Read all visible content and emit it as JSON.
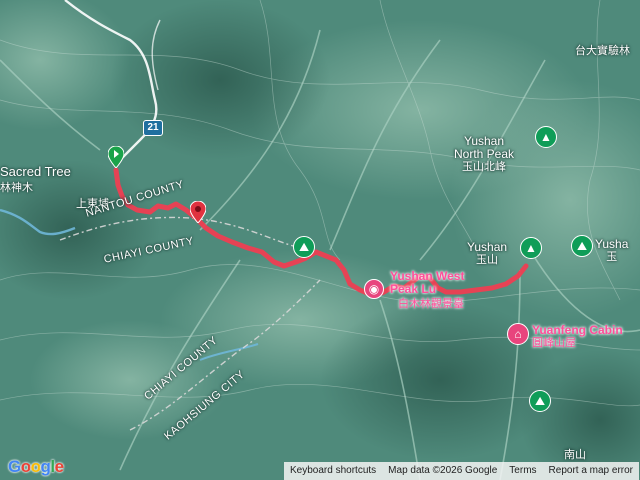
{
  "map": {
    "colors": {
      "terrain": "#4f8a7b",
      "ridge": "#8ab8a6",
      "valley": "#2f5e52",
      "contour": "#c9ddd5",
      "track": "#ee3e52",
      "road": "#ffffff",
      "boundary": "#d8d8d8",
      "river": "#6fb7d8"
    },
    "labels": {
      "sacred_tree_en": "Sacred Tree",
      "sacred_tree_zh": "林神木",
      "shangdongpu": "上東埔",
      "nantou_county": "NANTOU COUNTY",
      "chiayi_county_1": "CHIAYI COUNTY",
      "chiayi_county_2": "CHIAYI COUNTY",
      "kaohsiung_city": "KAOHSIUNG CITY",
      "ntu_forest": "台大實驗林",
      "yushan_north_en": "Yushan\nNorth Peak",
      "yushan_north_zh": "玉山北峰",
      "yushan_en": "Yushan",
      "yushan_zh": "玉山",
      "yushan_right_en": "Yusha",
      "yushan_right_zh": "玉",
      "yushan_west_en": "Yushan West\nPeak Lu",
      "baimulin_zh": "白木林觀景臺",
      "yuanfeng_cabin_en": "Yuanfeng Cabin",
      "yuanfeng_cabin_zh": "圓峰山屋",
      "nanshan_zh": "南山",
      "highway_number": "21"
    },
    "icons": [
      "start-pin-icon",
      "end-pin-icon",
      "hiking-peak-icon",
      "mountain-peak-icon",
      "cabin-icon",
      "viewpoint-icon",
      "highway-shield-icon"
    ],
    "attribution": {
      "keyboard": "Keyboard shortcuts",
      "mapdata": "Map data ©2026 Google",
      "terms": "Terms",
      "report": "Report a map error"
    },
    "logo": "Google"
  }
}
